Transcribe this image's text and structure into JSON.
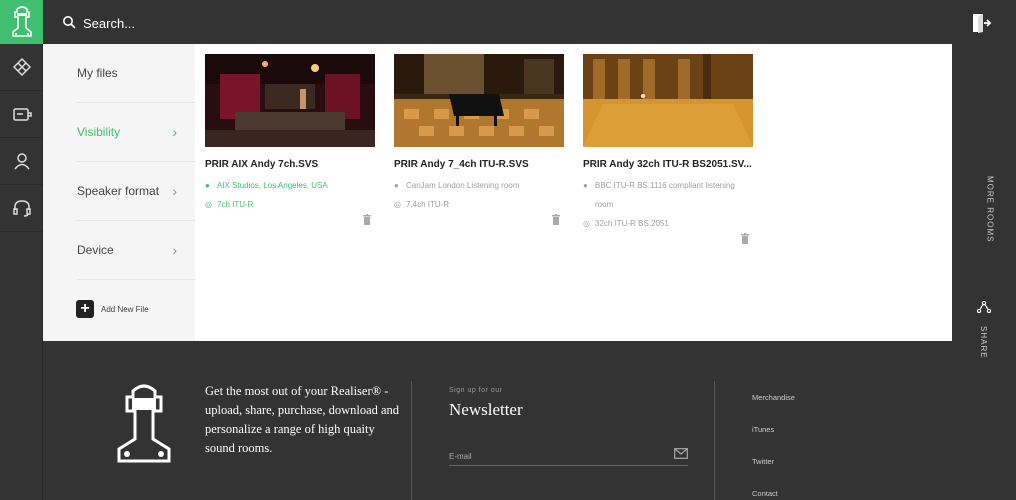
{
  "header": {
    "search_placeholder": "Search..."
  },
  "sidebar": {
    "items": [
      {
        "label": "My files",
        "active": false,
        "chevron": false
      },
      {
        "label": "Visibility",
        "active": true,
        "chevron": true
      },
      {
        "label": "Speaker format",
        "active": false,
        "chevron": true
      },
      {
        "label": "Device",
        "active": false,
        "chevron": true
      }
    ],
    "add_file_label": "Add New File"
  },
  "files": [
    {
      "title": "PRIR AIX Andy 7ch.SVS",
      "location": "AIX Studios, Los Angeles, USA",
      "format": "7ch ITU-R",
      "highlight": true
    },
    {
      "title": "PRIR Andy 7_4ch ITU-R.SVS",
      "location": "CanJam London Listening room",
      "format": "7.4ch ITU-R",
      "highlight": false
    },
    {
      "title": "PRIR Andy 32ch ITU-R BS2051.SV...",
      "location": "BBC ITU-R BS.1116 compliant listening room",
      "format": "32ch ITU-R BS.2051",
      "highlight": false
    }
  ],
  "right_rail": {
    "more_rooms": "MORE ROOMS",
    "share": "SHARE"
  },
  "footer": {
    "tagline": "Get the most out of your Realiser® - upload, share, purchase, download and personalize a range of high quaity sound rooms.",
    "newsletter_small": "Sign up for our",
    "newsletter_title": "Newsletter",
    "email_placeholder": "E-mail",
    "links": [
      "Merchandise",
      "iTunes",
      "Twitter",
      "Contact"
    ]
  },
  "colors": {
    "accent": "#3fbf6f",
    "background": "#333333",
    "panel": "#f5f5f5"
  }
}
